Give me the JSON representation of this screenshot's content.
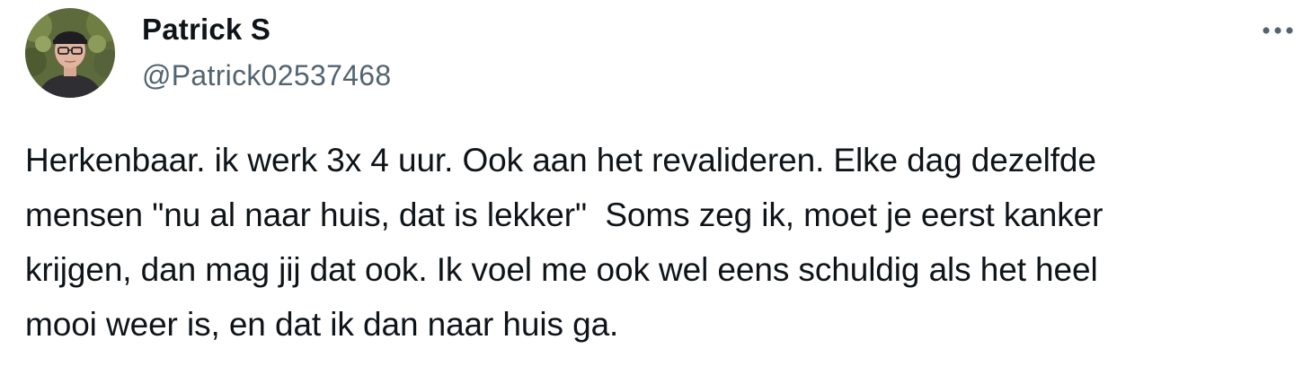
{
  "author": {
    "display_name": "Patrick S",
    "handle": "@Patrick02537468",
    "avatar_icon": "profile-photo"
  },
  "menu": {
    "icon": "more-horizontal-icon"
  },
  "tweet": {
    "text": "Herkenbaar. ik werk 3x 4 uur. Ook aan het revalideren. Elke dag dezelfde\nmensen \"nu al naar huis, dat is lekker\"  Soms zeg ik, moet je eerst kanker\nkrijgen, dan mag jij dat ook. Ik voel me ook wel eens schuldig als het heel\nmooi weer is, en dat ik dan naar huis ga."
  },
  "colors": {
    "text_primary": "#0f1419",
    "text_secondary": "#536471",
    "background": "#ffffff"
  }
}
